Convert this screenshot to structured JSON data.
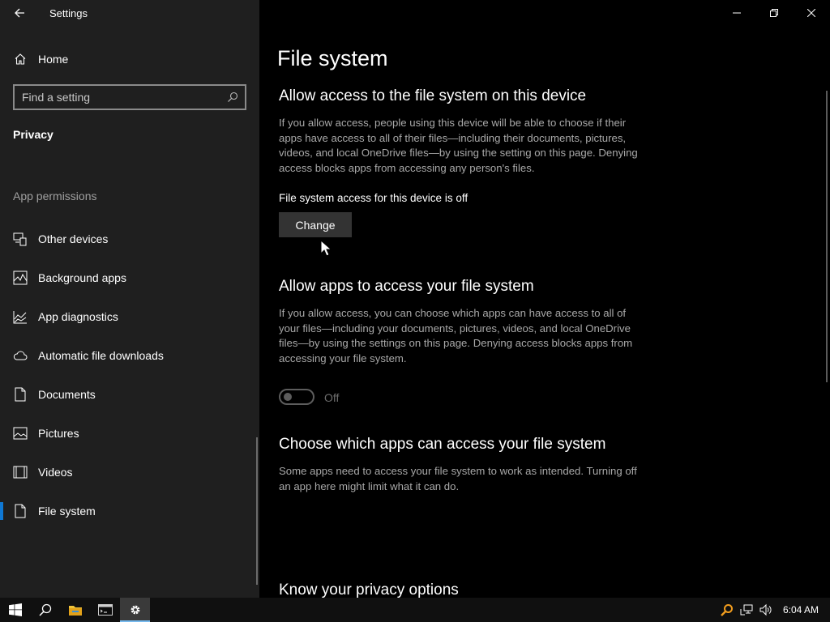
{
  "window": {
    "title": "Settings"
  },
  "sidebar": {
    "home_label": "Home",
    "search_placeholder": "Find a setting",
    "section_title": "Privacy",
    "group_label": "App permissions",
    "items": [
      {
        "label": "Other devices",
        "icon": "other-devices-icon"
      },
      {
        "label": "Background apps",
        "icon": "background-apps-icon"
      },
      {
        "label": "App diagnostics",
        "icon": "app-diagnostics-icon"
      },
      {
        "label": "Automatic file downloads",
        "icon": "cloud-icon"
      },
      {
        "label": "Documents",
        "icon": "document-icon"
      },
      {
        "label": "Pictures",
        "icon": "picture-icon"
      },
      {
        "label": "Videos",
        "icon": "video-icon"
      },
      {
        "label": "File system",
        "icon": "file-icon",
        "selected": true
      }
    ]
  },
  "main": {
    "page_title": "File system",
    "section1": {
      "heading": "Allow access to the file system on this device",
      "description": "If you allow access, people using this device will be able to choose if their apps have access to all of their files—including their documents, pictures, videos, and local OneDrive files—by using the setting on this page. Denying access blocks apps from accessing any person's files.",
      "status": "File system access for this device is off",
      "button_label": "Change"
    },
    "section2": {
      "heading": "Allow apps to access your file system",
      "description": "If you allow access, you can choose which apps can have access to all of your files—including your documents, pictures, videos, and local OneDrive files—by using the settings on this page. Denying access blocks apps from accessing your file system.",
      "toggle_label": "Off",
      "toggle_on": false
    },
    "section3": {
      "heading": "Choose which apps can access your file system",
      "description": "Some apps need to access your file system to work as intended. Turning off an app here might limit what it can do."
    },
    "section4": {
      "heading": "Know your privacy options"
    }
  },
  "taskbar": {
    "clock": "6:04 AM",
    "apps": [
      "start-icon",
      "search-icon",
      "file-explorer-icon",
      "command-prompt-icon",
      "settings-gear-icon"
    ]
  },
  "colors": {
    "accent": "#0f78d4",
    "sidebar_bg": "#1f1f1f",
    "main_bg": "#000000",
    "secondary_text": "#a8a8a8"
  }
}
